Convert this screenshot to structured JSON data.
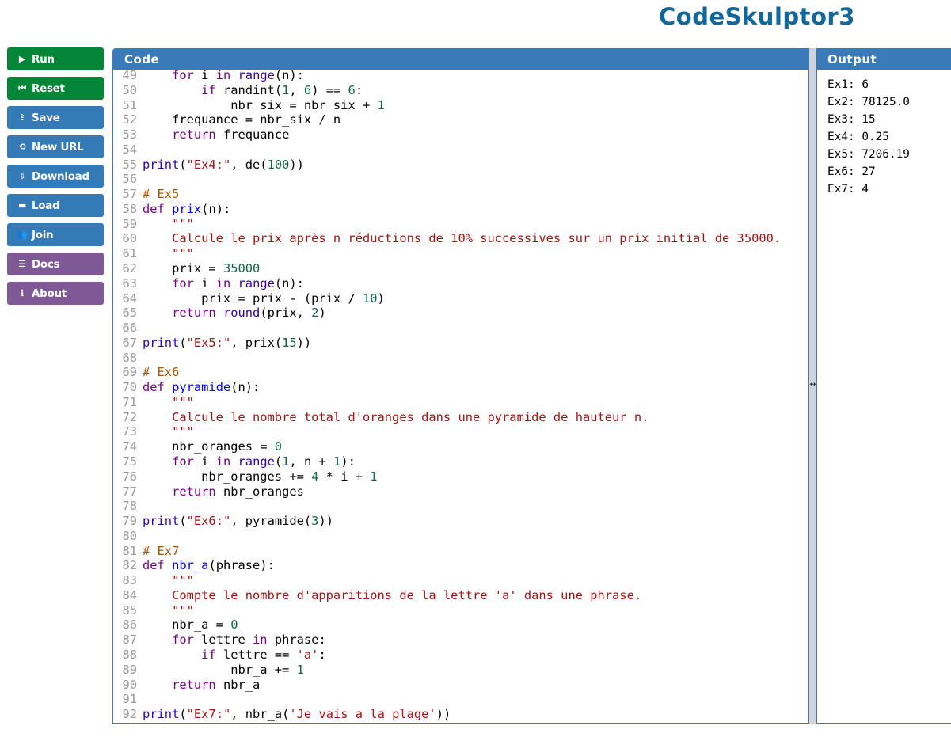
{
  "app": {
    "title": "CodeSkulptor3"
  },
  "sidebar": {
    "buttons": [
      {
        "label": "Run",
        "icon": "play-icon",
        "glyph": "▶",
        "color": "green"
      },
      {
        "label": "Reset",
        "icon": "reset-icon",
        "glyph": "⏮",
        "color": "green"
      },
      {
        "label": "Save",
        "icon": "cloud-upload-icon",
        "glyph": "⇪",
        "color": "blue"
      },
      {
        "label": "New URL",
        "icon": "link-icon",
        "glyph": "⟲",
        "color": "blue"
      },
      {
        "label": "Download",
        "icon": "cloud-download-icon",
        "glyph": "⇩",
        "color": "blue"
      },
      {
        "label": "Load",
        "icon": "folder-icon",
        "glyph": "▬",
        "color": "blue"
      },
      {
        "label": "Join",
        "icon": "users-icon",
        "glyph": "👥",
        "color": "blue"
      },
      {
        "label": "Docs",
        "icon": "list-icon",
        "glyph": "☰",
        "color": "purple"
      },
      {
        "label": "About",
        "icon": "info-icon",
        "glyph": "ℹ",
        "color": "purple"
      }
    ]
  },
  "code": {
    "title": "Code",
    "first_line": 49,
    "lines": [
      [
        [
          "",
          "    "
        ],
        [
          "k",
          "for"
        ],
        [
          "",
          " i "
        ],
        [
          "k",
          "in"
        ],
        [
          "",
          " "
        ],
        [
          "b",
          "range"
        ],
        [
          "",
          "(n):"
        ]
      ],
      [
        [
          "",
          "        "
        ],
        [
          "k",
          "if"
        ],
        [
          "",
          " randint("
        ],
        [
          "n",
          "1"
        ],
        [
          "",
          ", "
        ],
        [
          "n",
          "6"
        ],
        [
          "",
          ") == "
        ],
        [
          "n",
          "6"
        ],
        [
          "",
          ":"
        ]
      ],
      [
        [
          "",
          "            nbr_six = nbr_six + "
        ],
        [
          "n",
          "1"
        ]
      ],
      [
        [
          "",
          "    frequance = nbr_six / n"
        ]
      ],
      [
        [
          "",
          "    "
        ],
        [
          "k",
          "return"
        ],
        [
          "",
          " frequance"
        ]
      ],
      [],
      [
        [
          "b",
          "print"
        ],
        [
          "",
          "("
        ],
        [
          "s",
          "\"Ex4:\""
        ],
        [
          "",
          ", de("
        ],
        [
          "n",
          "100"
        ],
        [
          "",
          "))"
        ]
      ],
      [],
      [
        [
          "c",
          "# Ex5"
        ]
      ],
      [
        [
          "k",
          "def"
        ],
        [
          "",
          " "
        ],
        [
          "d",
          "prix"
        ],
        [
          "",
          "(n):"
        ]
      ],
      [
        [
          "",
          "    "
        ],
        [
          "s",
          "\"\"\""
        ]
      ],
      [
        [
          "",
          "    "
        ],
        [
          "s",
          "Calcule le prix après n réductions de 10% successives sur un prix initial de 35000."
        ]
      ],
      [
        [
          "",
          "    "
        ],
        [
          "s",
          "\"\"\""
        ]
      ],
      [
        [
          "",
          "    prix = "
        ],
        [
          "n",
          "35000"
        ]
      ],
      [
        [
          "",
          "    "
        ],
        [
          "k",
          "for"
        ],
        [
          "",
          " i "
        ],
        [
          "k",
          "in"
        ],
        [
          "",
          " "
        ],
        [
          "b",
          "range"
        ],
        [
          "",
          "(n):"
        ]
      ],
      [
        [
          "",
          "        prix = prix - (prix / "
        ],
        [
          "n",
          "10"
        ],
        [
          "",
          ")"
        ]
      ],
      [
        [
          "",
          "    "
        ],
        [
          "k",
          "return"
        ],
        [
          "",
          " "
        ],
        [
          "b",
          "round"
        ],
        [
          "",
          "(prix, "
        ],
        [
          "n",
          "2"
        ],
        [
          "",
          ")"
        ]
      ],
      [],
      [
        [
          "b",
          "print"
        ],
        [
          "",
          "("
        ],
        [
          "s",
          "\"Ex5:\""
        ],
        [
          "",
          ", prix("
        ],
        [
          "n",
          "15"
        ],
        [
          "",
          "))"
        ]
      ],
      [],
      [
        [
          "c",
          "# Ex6"
        ]
      ],
      [
        [
          "k",
          "def"
        ],
        [
          "",
          " "
        ],
        [
          "d",
          "pyramide"
        ],
        [
          "",
          "(n):"
        ]
      ],
      [
        [
          "",
          "    "
        ],
        [
          "s",
          "\"\"\""
        ]
      ],
      [
        [
          "",
          "    "
        ],
        [
          "s",
          "Calcule le nombre total d'oranges dans une pyramide de hauteur n."
        ]
      ],
      [
        [
          "",
          "    "
        ],
        [
          "s",
          "\"\"\""
        ]
      ],
      [
        [
          "",
          "    nbr_oranges = "
        ],
        [
          "n",
          "0"
        ]
      ],
      [
        [
          "",
          "    "
        ],
        [
          "k",
          "for"
        ],
        [
          "",
          " i "
        ],
        [
          "k",
          "in"
        ],
        [
          "",
          " "
        ],
        [
          "b",
          "range"
        ],
        [
          "",
          "("
        ],
        [
          "n",
          "1"
        ],
        [
          "",
          ", n + "
        ],
        [
          "n",
          "1"
        ],
        [
          "",
          "):"
        ]
      ],
      [
        [
          "",
          "        nbr_oranges += "
        ],
        [
          "n",
          "4"
        ],
        [
          "",
          " * i + "
        ],
        [
          "n",
          "1"
        ]
      ],
      [
        [
          "",
          "    "
        ],
        [
          "k",
          "return"
        ],
        [
          "",
          " nbr_oranges"
        ]
      ],
      [],
      [
        [
          "b",
          "print"
        ],
        [
          "",
          "("
        ],
        [
          "s",
          "\"Ex6:\""
        ],
        [
          "",
          ", pyramide("
        ],
        [
          "n",
          "3"
        ],
        [
          "",
          "))"
        ]
      ],
      [],
      [
        [
          "c",
          "# Ex7"
        ]
      ],
      [
        [
          "k",
          "def"
        ],
        [
          "",
          " "
        ],
        [
          "d",
          "nbr_a"
        ],
        [
          "",
          "(phrase):"
        ]
      ],
      [
        [
          "",
          "    "
        ],
        [
          "s",
          "\"\"\""
        ]
      ],
      [
        [
          "",
          "    "
        ],
        [
          "s",
          "Compte le nombre d'apparitions de la lettre 'a' dans une phrase."
        ]
      ],
      [
        [
          "",
          "    "
        ],
        [
          "s",
          "\"\"\""
        ]
      ],
      [
        [
          "",
          "    nbr_a = "
        ],
        [
          "n",
          "0"
        ]
      ],
      [
        [
          "",
          "    "
        ],
        [
          "k",
          "for"
        ],
        [
          "",
          " lettre "
        ],
        [
          "k",
          "in"
        ],
        [
          "",
          " phrase:"
        ]
      ],
      [
        [
          "",
          "        "
        ],
        [
          "k",
          "if"
        ],
        [
          "",
          " lettre == "
        ],
        [
          "s",
          "'a'"
        ],
        [
          "",
          ":"
        ]
      ],
      [
        [
          "",
          "            nbr_a += "
        ],
        [
          "n",
          "1"
        ]
      ],
      [
        [
          "",
          "    "
        ],
        [
          "k",
          "return"
        ],
        [
          "",
          " nbr_a"
        ]
      ],
      [],
      [
        [
          "b",
          "print"
        ],
        [
          "",
          "("
        ],
        [
          "s",
          "\"Ex7:\""
        ],
        [
          "",
          ", nbr_a("
        ],
        [
          "s",
          "'Je vais a la plage'"
        ],
        [
          "",
          "))"
        ]
      ]
    ]
  },
  "splitter": {
    "glyph": "↔"
  },
  "output": {
    "title": "Output",
    "lines": [
      "Ex1: 6",
      "Ex2: 78125.0",
      "Ex3: 15",
      "Ex4: 0.25",
      "Ex5: 7206.19",
      "Ex6: 27",
      "Ex7: 4"
    ]
  }
}
